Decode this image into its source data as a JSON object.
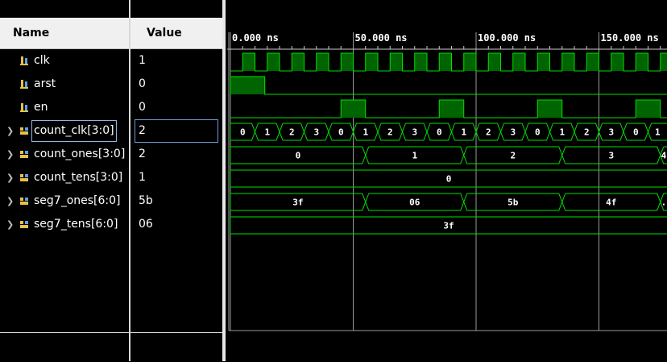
{
  "headers": {
    "name": "Name",
    "value": "Value"
  },
  "signals": [
    {
      "name": "clk",
      "value": "1",
      "kind": "bit",
      "expandable": false,
      "icon": "bit-signal-icon"
    },
    {
      "name": "arst",
      "value": "0",
      "kind": "bit",
      "expandable": false,
      "icon": "bit-signal-icon"
    },
    {
      "name": "en",
      "value": "0",
      "kind": "bit",
      "expandable": false,
      "icon": "bit-signal-icon"
    },
    {
      "name": "count_clk[3:0]",
      "value": "2",
      "kind": "bus",
      "expandable": true,
      "icon": "bus-signal-icon",
      "selected": true
    },
    {
      "name": "count_ones[3:0]",
      "value": "2",
      "kind": "bus",
      "expandable": true,
      "icon": "bus-signal-icon"
    },
    {
      "name": "count_tens[3:0]",
      "value": "1",
      "kind": "bus",
      "expandable": true,
      "icon": "bus-signal-icon"
    },
    {
      "name": "seg7_ones[6:0]",
      "value": "5b",
      "kind": "bus",
      "expandable": true,
      "icon": "bus-signal-icon"
    },
    {
      "name": "seg7_tens[6:0]",
      "value": "06",
      "kind": "bus",
      "expandable": true,
      "icon": "bus-signal-icon"
    }
  ],
  "timeline": {
    "unit": "ns",
    "visible_range_ns": [
      0,
      180
    ],
    "tick_labels": [
      "0.000 ns",
      "50.000 ns",
      "100.000 ns",
      "150.000 ns"
    ],
    "tick_values_ns": [
      0,
      50,
      100,
      150
    ],
    "clock_period_ns": 10,
    "clock_first_rise_ns": 5
  },
  "waves": {
    "arst": {
      "high_intervals_ns": [
        [
          0,
          14
        ]
      ]
    },
    "en": {
      "high_intervals_ns": [
        [
          45,
          55
        ],
        [
          85,
          95
        ],
        [
          125,
          135
        ],
        [
          165,
          175
        ]
      ]
    },
    "count_clk": {
      "segments": [
        {
          "start": 0,
          "end": 10,
          "label": "0"
        },
        {
          "start": 10,
          "end": 20,
          "label": "1"
        },
        {
          "start": 20,
          "end": 30,
          "label": "2"
        },
        {
          "start": 30,
          "end": 40,
          "label": "3"
        },
        {
          "start": 40,
          "end": 50,
          "label": "0"
        },
        {
          "start": 50,
          "end": 60,
          "label": "1"
        },
        {
          "start": 60,
          "end": 70,
          "label": "2"
        },
        {
          "start": 70,
          "end": 80,
          "label": "3"
        },
        {
          "start": 80,
          "end": 90,
          "label": "0"
        },
        {
          "start": 90,
          "end": 100,
          "label": "1"
        },
        {
          "start": 100,
          "end": 110,
          "label": "2"
        },
        {
          "start": 110,
          "end": 120,
          "label": "3"
        },
        {
          "start": 120,
          "end": 130,
          "label": "0"
        },
        {
          "start": 130,
          "end": 140,
          "label": "1"
        },
        {
          "start": 140,
          "end": 150,
          "label": "2"
        },
        {
          "start": 150,
          "end": 160,
          "label": "3"
        },
        {
          "start": 160,
          "end": 170,
          "label": "0"
        },
        {
          "start": 170,
          "end": 180,
          "label": "1"
        }
      ]
    },
    "count_ones": {
      "segments": [
        {
          "start": 0,
          "end": 55,
          "label": "0"
        },
        {
          "start": 55,
          "end": 95,
          "label": "1"
        },
        {
          "start": 95,
          "end": 135,
          "label": "2"
        },
        {
          "start": 135,
          "end": 175,
          "label": "3"
        },
        {
          "start": 175,
          "end": 180,
          "label": "4"
        }
      ]
    },
    "count_tens": {
      "segments": [
        {
          "start": 0,
          "end": 180,
          "label": "0"
        }
      ]
    },
    "seg7_ones": {
      "segments": [
        {
          "start": 0,
          "end": 55,
          "label": "3f"
        },
        {
          "start": 55,
          "end": 95,
          "label": "06"
        },
        {
          "start": 95,
          "end": 135,
          "label": "5b"
        },
        {
          "start": 135,
          "end": 175,
          "label": "4f"
        },
        {
          "start": 175,
          "end": 180,
          "label": "."
        }
      ]
    },
    "seg7_tens": {
      "segments": [
        {
          "start": 0,
          "end": 180,
          "label": "3f"
        }
      ]
    }
  },
  "colors": {
    "wave": "#00e000",
    "wave_fill": "#006400",
    "grid": "#9a9a9a",
    "header_bg": "#f0f0f0",
    "selection": "#6e9bd6"
  }
}
